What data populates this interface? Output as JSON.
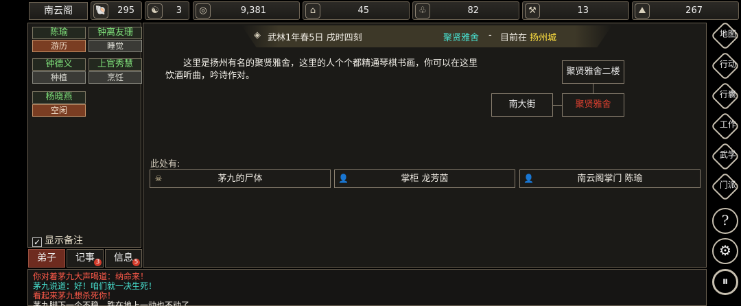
{
  "resources": [
    {
      "icon": "🐚",
      "value": "295",
      "name": "shell"
    },
    {
      "icon": "☯",
      "value": "3",
      "name": "yinyang"
    },
    {
      "icon": "◎",
      "value": "9,381",
      "name": "coin"
    },
    {
      "icon": "⌂",
      "value": "45",
      "name": "food"
    },
    {
      "icon": "♧",
      "value": "82",
      "name": "herb"
    },
    {
      "icon": "⚒",
      "value": "13",
      "name": "wood"
    },
    {
      "icon": "⛰",
      "value": "267",
      "name": "ore"
    }
  ],
  "sect_name": "南云阁",
  "disciples": [
    {
      "name": "陈瑜",
      "status": "游历",
      "busy": true
    },
    {
      "name": "钟离友珊",
      "status": "睡觉",
      "busy": false
    },
    {
      "name": "钟德义",
      "status": "种植",
      "busy": false
    },
    {
      "name": "上官秀慧",
      "status": "烹饪",
      "busy": false
    },
    {
      "name": "杨晓燕",
      "status": "空闲",
      "busy": true
    }
  ],
  "show_notes_label": "显示备注",
  "tabs": [
    {
      "label": "弟子",
      "badge": ""
    },
    {
      "label": "记事",
      "badge": "3"
    },
    {
      "label": "信息",
      "badge": "5"
    }
  ],
  "header": {
    "date": "武林1年春5日 戌时四刻",
    "location": "聚贤雅舍",
    "sep": "-",
    "current_prefix": "目前在",
    "city": "扬州城"
  },
  "description": "这里是扬州有名的聚贤雅舍，这里的人个个都精通琴棋书画，你可以在这里饮酒听曲，吟诗作对。",
  "rooms": {
    "upstairs": "聚贤雅舍二楼",
    "street": "南大街",
    "current": "聚贤雅舍"
  },
  "here_label": "此处有:",
  "entities": [
    {
      "icon": "☠",
      "label": "茅九的尸体"
    },
    {
      "icon": "👤",
      "label": "掌柜 龙芳茵"
    },
    {
      "icon": "👤",
      "label": "南云阁掌门 陈瑜"
    }
  ],
  "side_buttons": [
    "地图",
    "行动",
    "行囊",
    "工作",
    "武学",
    "门派",
    "?",
    "⚙",
    "⏸"
  ],
  "log": [
    {
      "text": "你对着茅九大声喝道：纳命来！",
      "color": "#ff5a4a"
    },
    {
      "text": "茅九说道：好！咱们就一决生死！",
      "color": "#48e0d0"
    },
    {
      "text": "看起来茅九想杀死你！",
      "color": "#ff5a4a"
    },
    {
      "text": "茅九脚下一个不稳，跌在地上一动也不动了。",
      "color": "#f0ece4"
    }
  ],
  "colors": {
    "accent_red": "#7a3d22",
    "name_green": "#7fe07a",
    "location_cyan": "#48e0d0",
    "city_yellow": "#ffe040"
  }
}
